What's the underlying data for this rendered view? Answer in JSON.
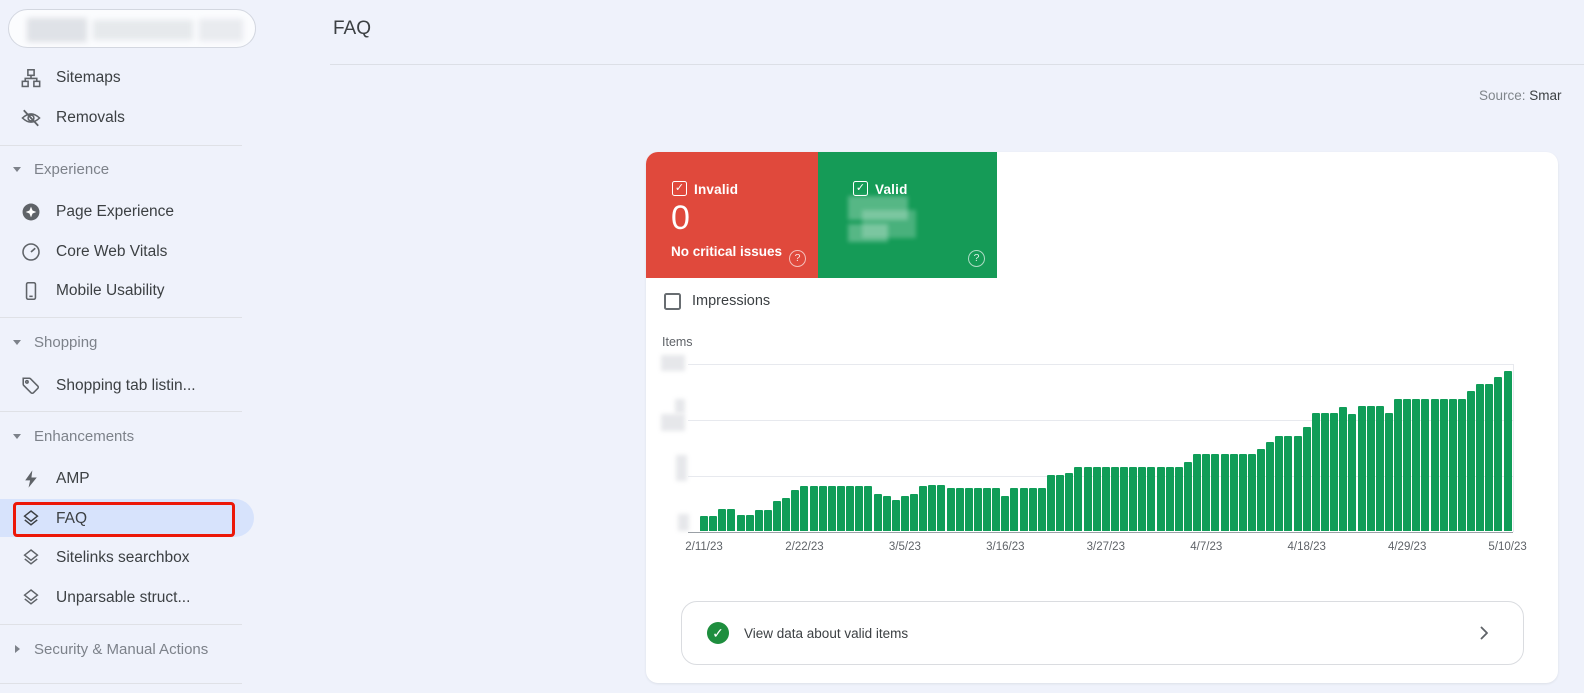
{
  "glyphs": {
    "check": "✓",
    "help": "?"
  },
  "sidebar": {
    "property_selector": {
      "redacted": true
    },
    "top_items": [
      {
        "label": "Sitemaps"
      },
      {
        "label": "Removals"
      }
    ],
    "sections": [
      {
        "label": "Experience",
        "expanded": true,
        "items": [
          {
            "label": "Page Experience"
          },
          {
            "label": "Core Web Vitals"
          },
          {
            "label": "Mobile Usability"
          }
        ]
      },
      {
        "label": "Shopping",
        "expanded": true,
        "items": [
          {
            "label": "Shopping tab listin..."
          }
        ]
      },
      {
        "label": "Enhancements",
        "expanded": true,
        "selected_item": "FAQ",
        "items": [
          {
            "label": "AMP"
          },
          {
            "label": "FAQ"
          },
          {
            "label": "Sitelinks searchbox"
          },
          {
            "label": "Unparsable struct..."
          }
        ]
      },
      {
        "label": "Security & Manual Actions",
        "expanded": false,
        "items": []
      }
    ],
    "selected_highlight_color": "#d7e3fc",
    "annotation_box_color": "#ec1708"
  },
  "header": {
    "title": "FAQ",
    "source_label": "Source:",
    "source_value": "Smar"
  },
  "status_cards": {
    "invalid": {
      "label": "Invalid",
      "value": "0",
      "caption": "No critical issues",
      "checked": true,
      "color": "#e0493c"
    },
    "valid": {
      "label": "Valid",
      "value_redacted": true,
      "checked": true,
      "color": "#159b57"
    }
  },
  "controls": {
    "impressions": {
      "label": "Impressions",
      "checked": false
    }
  },
  "chart_data": {
    "type": "bar",
    "title": "Items",
    "ylabel": "Items",
    "series_name": "Valid items",
    "y_axis_note": "y-axis tick values redacted in screenshot; values are relative units",
    "x_labels": [
      "2/11/23",
      "2/22/23",
      "3/5/23",
      "3/16/23",
      "3/27/23",
      "4/7/23",
      "4/18/23",
      "4/29/23",
      "5/10/23"
    ],
    "label_indices": [
      0,
      11,
      22,
      33,
      44,
      55,
      66,
      77,
      88
    ],
    "date_start": "2/11/23",
    "date_end": "5/10/23",
    "ylim": [
      0,
      168
    ],
    "grid": true,
    "legend": false,
    "bar_color": "#109d58",
    "values": [
      15,
      15,
      22,
      22,
      16,
      16,
      21,
      21,
      30,
      33,
      41,
      45,
      45,
      45,
      45,
      45,
      45,
      45,
      45,
      37,
      35,
      31,
      35,
      37,
      45,
      46,
      46,
      43,
      43,
      43,
      43,
      43,
      43,
      35,
      43,
      43,
      43,
      43,
      56,
      56,
      58,
      64,
      64,
      64,
      64,
      64,
      64,
      64,
      64,
      64,
      64,
      64,
      64,
      69,
      77,
      77,
      77,
      77,
      77,
      77,
      77,
      82,
      89,
      95,
      95,
      95,
      104,
      118,
      118,
      118,
      124,
      117,
      125,
      125,
      125,
      118,
      132,
      132,
      132,
      132,
      132,
      132,
      132,
      132,
      140,
      147,
      147,
      154,
      160
    ]
  },
  "footer": {
    "label": "View data about valid items"
  }
}
